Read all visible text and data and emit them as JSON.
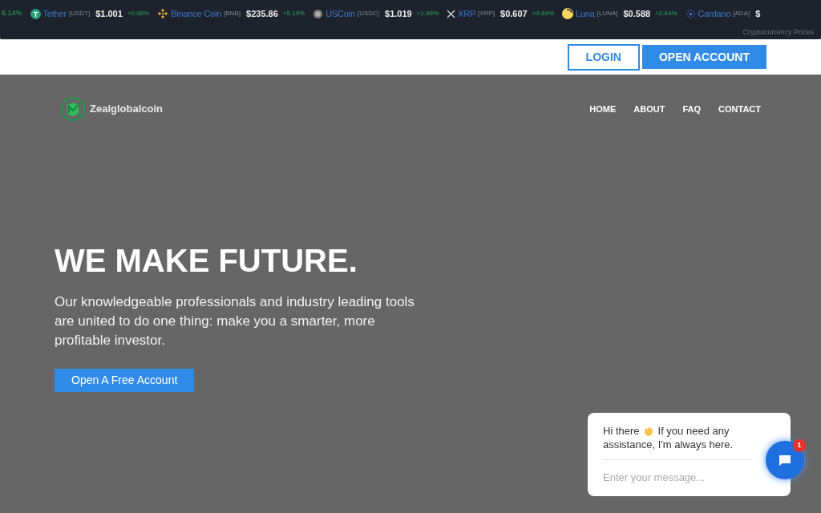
{
  "ticker": {
    "items": [
      {
        "kind": "partial",
        "change": "6.14%"
      },
      {
        "kind": "coin",
        "name": "Tether",
        "symbol": "[USDT]",
        "price": "$1.001",
        "change": "+0.08%"
      },
      {
        "kind": "coin",
        "name": "Binance Coin",
        "symbol": "[BNB]",
        "price": "$235.86",
        "change": "+5.10%"
      },
      {
        "kind": "coin",
        "name": "USCoin",
        "symbol": "[USDC]",
        "price": "$1.019",
        "change": "+1.99%"
      },
      {
        "kind": "coin",
        "name": "XRP",
        "symbol": "[XRP]",
        "price": "$0.607",
        "change": "+4.84%"
      },
      {
        "kind": "coin",
        "name": "Luna",
        "symbol": "[LUNA]",
        "price": "$0.588",
        "change": "+2.64%"
      },
      {
        "kind": "coin",
        "name": "Cardano",
        "symbol": "[ADA]",
        "price": "$"
      }
    ],
    "caption": "Cryptocurrency Prices"
  },
  "topbar": {
    "buttons": [
      {
        "kind": "outline",
        "label": "LOGIN"
      },
      {
        "kind": "solid",
        "label": "OPEN ACCOUNT"
      }
    ]
  },
  "brand": "Zealglobalcoin",
  "nav": [
    "HOME",
    "ABOUT",
    "FAQ",
    "CONTACT"
  ],
  "hero": {
    "title": "WE MAKE FUTURE.",
    "text": "Our knowledgeable professionals and industry leading tools are united to do one thing: make you a smarter, more profitable investor.",
    "button": "Open A Free Account"
  },
  "chat": {
    "greeting_start": "Hi there",
    "greeting_end": "If you need any",
    "greeting_line_2": "assistance, I'm always here.",
    "placeholder": "Enter your message...",
    "badge": "1"
  }
}
